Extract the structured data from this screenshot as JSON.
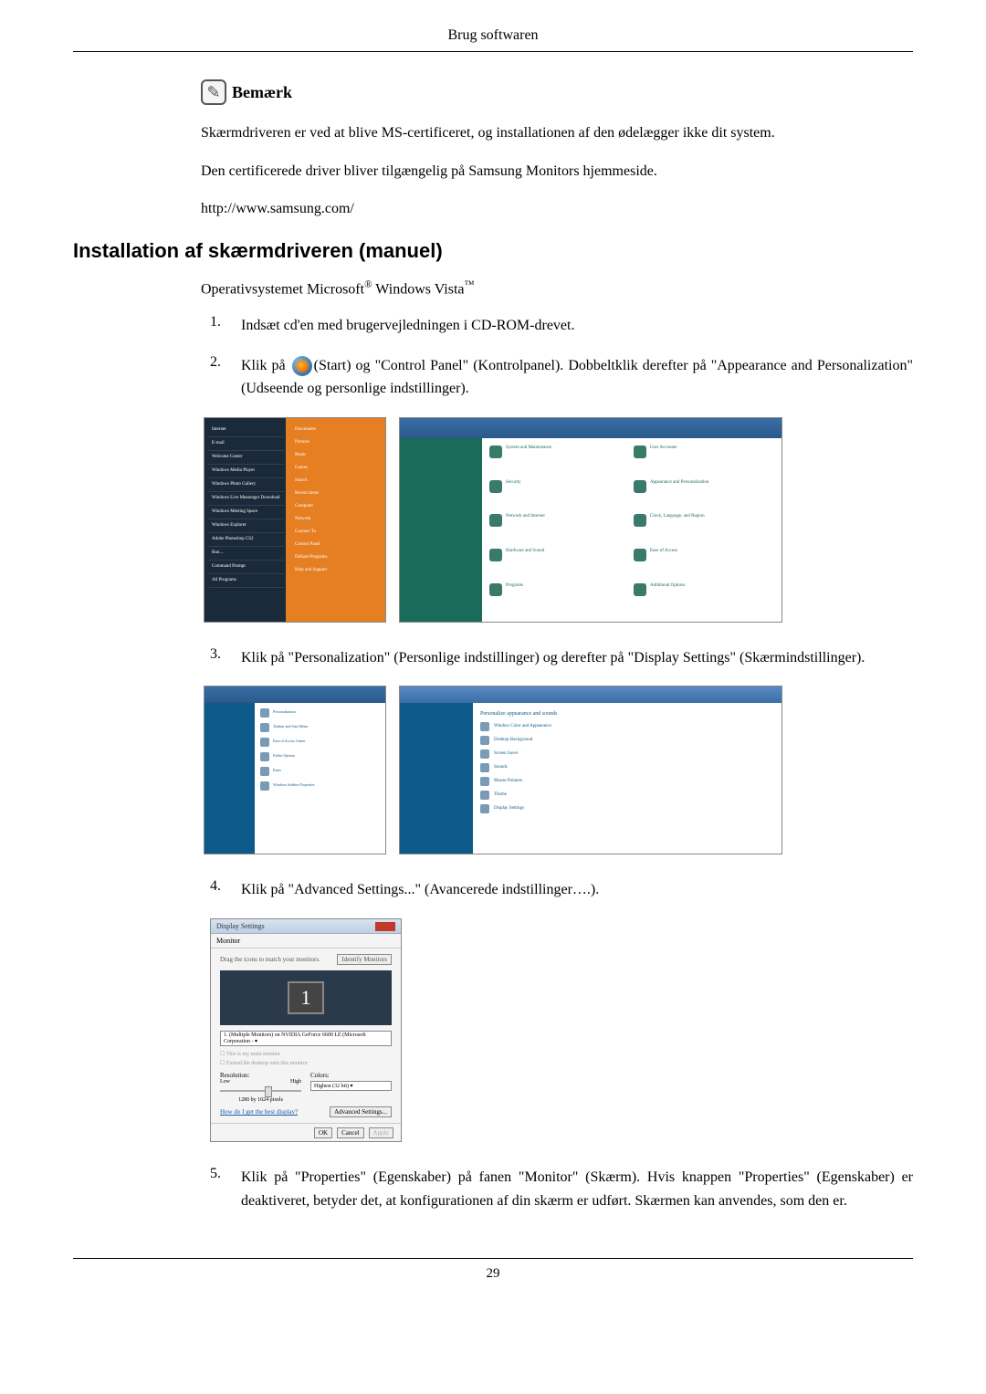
{
  "header": "Brug softwaren",
  "note": {
    "label": "Bemærk",
    "line1": "Skærmdriveren er ved at blive MS-certificeret, og installationen af den ødelægger ikke dit system.",
    "line2": "Den certificerede driver bliver tilgængelig på Samsung Monitors hjemmeside.",
    "url": "http://www.samsung.com/"
  },
  "section_title": "Installation af skærmdriveren (manuel)",
  "intro_prefix": "Operativsystemet Microsoft",
  "intro_sup1": "®",
  "intro_mid": " Windows Vista",
  "intro_sup2": "™",
  "steps": {
    "s1": {
      "n": "1.",
      "text": "Indsæt cd'en med brugervejledningen i CD-ROM-drevet."
    },
    "s2": {
      "n": "2.",
      "before": "Klik på ",
      "after": "(Start) og \"Control Panel\" (Kontrolpanel). Dobbeltklik derefter på \"Appearance and Personalization\" (Udseende og personlige indstillinger)."
    },
    "s3": {
      "n": "3.",
      "text": "Klik på \"Personalization\" (Personlige indstillinger) og derefter på \"Display Settings\" (Skærmindstillinger)."
    },
    "s4": {
      "n": "4.",
      "text": "Klik på \"Advanced Settings...\" (Avancerede indstillinger….)."
    },
    "s5": {
      "n": "5.",
      "text": "Klik på \"Properties\" (Egenskaber) på fanen \"Monitor\" (Skærm). Hvis knappen \"Properties\" (Egenskaber) er deaktiveret, betyder det, at konfigurationen af din skærm er udført. Skærmen kan anvendes, som den er."
    }
  },
  "display_dialog": {
    "title": "Display Settings",
    "tab": "Monitor",
    "drag_text": "Drag the icons to match your monitors.",
    "identify": "Identify Monitors",
    "monitor_num": "1",
    "dropdown": "1. (Multiple Monitors) on NVIDIA GeForce 6600 LE (Microsoft Corporation - ▾",
    "check1": "☐ This is my main monitor",
    "check2": "☐ Extend the desktop onto this monitor",
    "res_label": "Resolution:",
    "low": "Low",
    "high": "High",
    "res_value": "1280 by 1024 pixels",
    "color_label": "Colors:",
    "color_value": "Highest (32 bit)   ▾",
    "link": "How do I get the best display?",
    "advanced": "Advanced Settings...",
    "ok": "OK",
    "cancel": "Cancel",
    "apply": "Apply"
  },
  "cp": {
    "sys": "System and Maintenance",
    "user": "User Accounts",
    "sec": "Security",
    "appear": "Appearance and Personalization",
    "net": "Network and Internet",
    "clock": "Clock, Language, and Region",
    "hw": "Hardware and Sound",
    "ease": "Ease of Access",
    "prog": "Programs",
    "add": "Additional Options",
    "personalize_title": "Personalize appearance and sounds"
  },
  "page_number": "29"
}
